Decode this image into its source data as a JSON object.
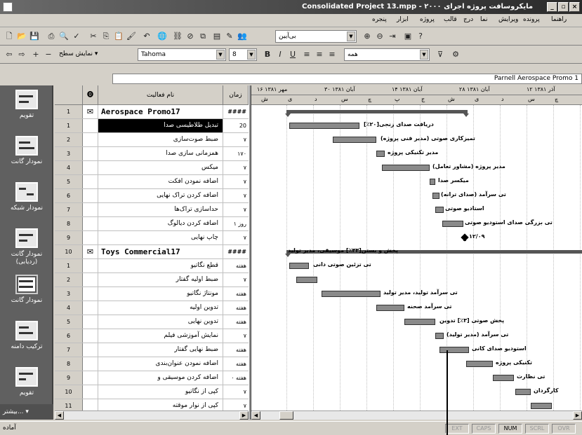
{
  "window": {
    "title": "Consolidated Project 13.mpp - ۲۰۰۰ مایکروسافت پروژه اجرای"
  },
  "menu": [
    "پنجره",
    "ابزار",
    "پروژه",
    "قالب",
    "درج",
    "نما",
    "ویرایش",
    "پرونده",
    "راهنما"
  ],
  "toolbar1": {
    "filter_value": "بی‌آیین",
    "icons": [
      "new-icon",
      "open-icon",
      "save-icon",
      "print-icon",
      "preview-icon",
      "spell-icon",
      "cut-icon",
      "copy-icon",
      "paste-icon",
      "format-painter-icon",
      "undo-icon",
      "hyperlink-icon",
      "link-icon",
      "unlink-icon",
      "split-icon",
      "task-info-icon",
      "notes-icon",
      "assign-icon",
      "zoom-in-icon",
      "zoom-out-icon",
      "goto-icon",
      "copy-picture-icon",
      "help-icon"
    ]
  },
  "toolbar2": {
    "show_label": "نمایش سطح",
    "font": "Tahoma",
    "size": "8",
    "all_tasks": "همه",
    "icons": [
      "outdent-icon",
      "indent-icon",
      "show-subtasks-icon",
      "hide-subtasks-icon",
      "bold-icon",
      "italic-icon",
      "underline-icon",
      "align-left-icon",
      "align-center-icon",
      "align-right-icon",
      "gantt-wizard-icon"
    ]
  },
  "entry": {
    "value": "Parnell Aerospace Promo 1"
  },
  "columns": {
    "indicators": "⓿",
    "name": "نام فعالیت",
    "duration": "زمان"
  },
  "rows": [
    {
      "id": "1",
      "ind": "✉",
      "name": "Aerospace Promo17",
      "dur": "####",
      "summary": true
    },
    {
      "id": "1",
      "name": "تبدیل طلاطیسی صدا",
      "dur": "20",
      "selected": true
    },
    {
      "id": "2",
      "name": "ضبط صوت‌سازی",
      "dur": "۷"
    },
    {
      "id": "3",
      "name": "همزمانی سازی صدا",
      "dur": "۱۷۰"
    },
    {
      "id": "4",
      "name": "میکس",
      "dur": "۷"
    },
    {
      "id": "5",
      "name": "اضافه نمودن افکت",
      "dur": "۷"
    },
    {
      "id": "6",
      "name": "اضافه کردن تراک نهایی",
      "dur": "۷"
    },
    {
      "id": "7",
      "name": "حداسازی تراک‌ها",
      "dur": "۷"
    },
    {
      "id": "8",
      "name": "اضافه کردن دیالوگ",
      "dur": "۱ روز"
    },
    {
      "id": "9",
      "name": "چاپ نهایی",
      "dur": "۷"
    },
    {
      "id": "10",
      "ind": "✉",
      "name": "Toys Commercial17",
      "dur": "####",
      "summary": true
    },
    {
      "id": "1",
      "name": "قطع نگاتیو",
      "dur": "هفته"
    },
    {
      "id": "2",
      "name": "ضبط اولیه گفتار",
      "dur": "۷"
    },
    {
      "id": "3",
      "name": "مونتاژ نگاتیو",
      "dur": "هفته"
    },
    {
      "id": "4",
      "name": "تدوین اولیه",
      "dur": "هفته"
    },
    {
      "id": "5",
      "name": "تدوین نهایی",
      "dur": "هفته"
    },
    {
      "id": "6",
      "name": "نمایش آموزشی فیلم",
      "dur": "۷"
    },
    {
      "id": "7",
      "name": "ضبط نهایی گفتار",
      "dur": "هفته"
    },
    {
      "id": "8",
      "name": "اضافه نمودن عنوان‌بندی",
      "dur": "هفته"
    },
    {
      "id": "9",
      "name": "اضافه کردن موسیقی و",
      "dur": "هفته ۰"
    },
    {
      "id": "10",
      "name": "کپی از نگاتیو",
      "dur": "۷"
    },
    {
      "id": "11",
      "name": "کپی از نوار موقته",
      "dur": "۷"
    }
  ],
  "viewbar": [
    {
      "label": "تقویم"
    },
    {
      "label": "نمودار گانت"
    },
    {
      "label": "نمودار شبکه"
    },
    {
      "label": "نمودار گانت (ردیابی)"
    },
    {
      "label": "تقویم"
    },
    {
      "label": "نمودار گانت",
      "selected": true
    },
    {
      "label": "ترکیب دامنه"
    }
  ],
  "viewbar_more": "بیشتر...",
  "timescale": {
    "top": [
      "۱۶ مهر ۱۳۸۱",
      "۳۰ آبان ۱۳۸۱",
      "۱۴ آبان ۱۳۸۱",
      "۲۸ آبان ۱۳۸۱",
      "۱۲ آذر ۱۳۸۱"
    ],
    "bottom": [
      "ش",
      "ی",
      "د",
      "س",
      "چ",
      "پ",
      "ج",
      "ش",
      "ی",
      "د",
      "س",
      "چ"
    ]
  },
  "gantt_labels": [
    {
      "t": "دریافت صدای زنجی[۲۰٪]"
    },
    {
      "t": "تمیزکاری صوتی (مدیر فنی پروژه)"
    },
    {
      "t": "مدیر تکنیکی پروژه"
    },
    {
      "t": "مدیر پروژه (مشاور تعامل)"
    },
    {
      "t": "میکسر صدا"
    },
    {
      "t": "تی سرآمد (صدای ترانه)"
    },
    {
      "t": "استادیو صوتی"
    },
    {
      "t": "تی بزرگی صدای استودیو صوتی"
    },
    {
      "t": "۱۲/۰۹"
    },
    {
      "t": "پخش و بستن[۳۳٪] موسیقی، مدیر تولید"
    },
    {
      "t": "تی تزئین صوتی دانی"
    },
    {
      "t": "تی سرآمد تولید، مدیر تولید"
    },
    {
      "t": "تی سرآمد صحنه"
    },
    {
      "t": "پخش صوتی [۳٪] تدوین"
    },
    {
      "t": "تی سرآمد (مدیر تولید)"
    },
    {
      "t": "استودیو صدای کانی"
    },
    {
      "t": "تکنیکی پروژه"
    },
    {
      "t": "تی نظارت"
    },
    {
      "t": "کارگردان"
    }
  ],
  "status": {
    "ready": "آماده",
    "ext": "EXT",
    "caps": "CAPS",
    "num": "NUM",
    "scrl": "SCRL",
    "ovr": "OVR"
  }
}
